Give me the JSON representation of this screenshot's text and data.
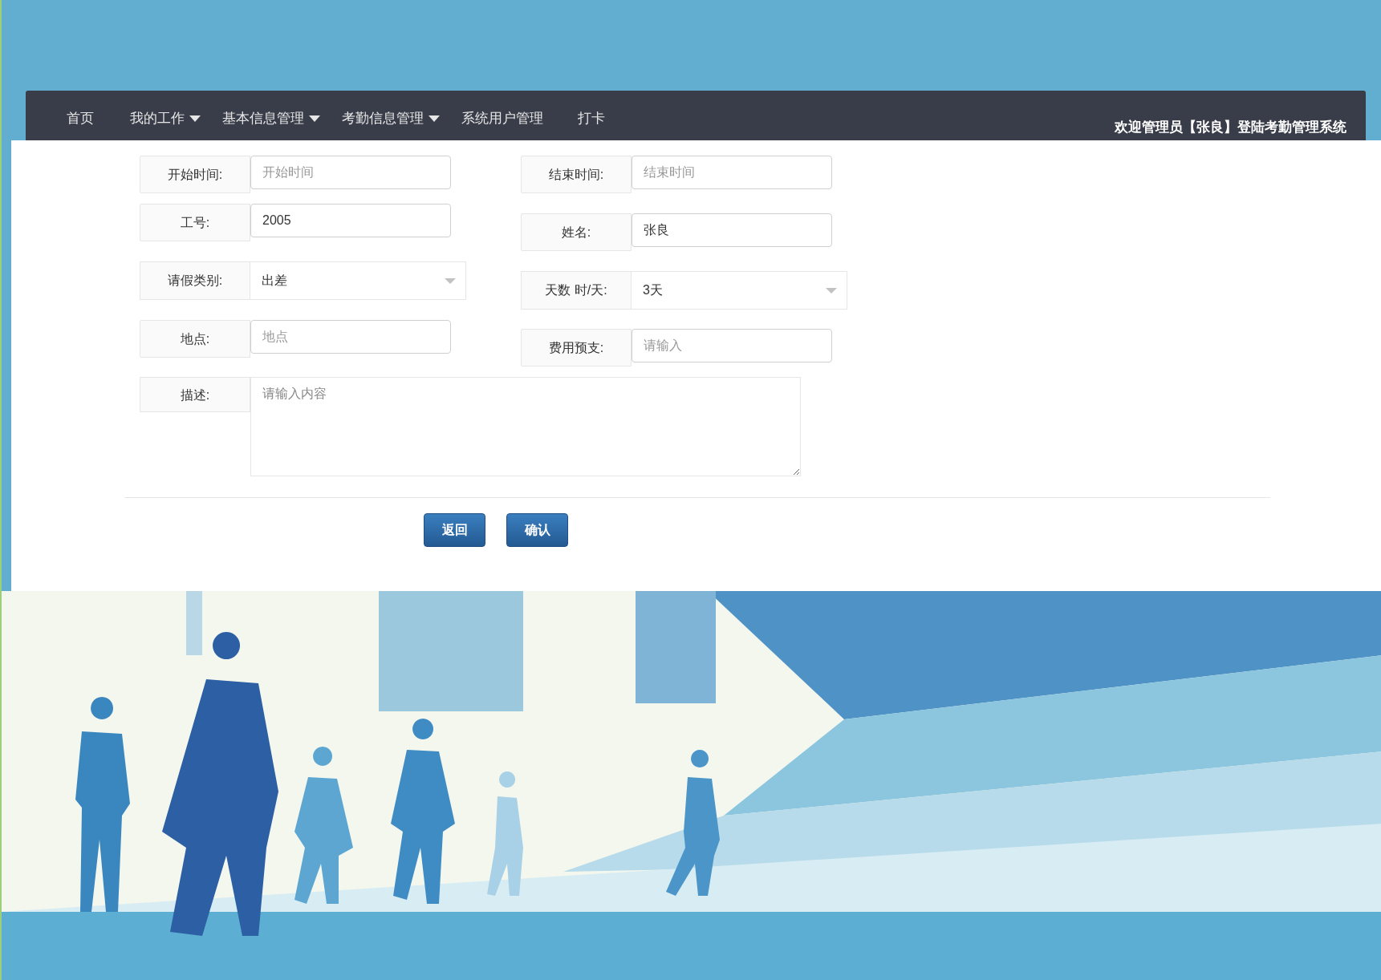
{
  "nav": {
    "items": [
      {
        "label": "首页",
        "dropdown": false
      },
      {
        "label": "我的工作",
        "dropdown": true
      },
      {
        "label": "基本信息管理",
        "dropdown": true
      },
      {
        "label": "考勤信息管理",
        "dropdown": true
      },
      {
        "label": "系统用户管理",
        "dropdown": false
      },
      {
        "label": "打卡",
        "dropdown": false
      }
    ],
    "welcome": "欢迎管理员【张良】登陆考勤管理系统"
  },
  "form": {
    "left": [
      {
        "kind": "input",
        "label": "开始时间:",
        "placeholder": "开始时间"
      },
      {
        "kind": "input",
        "label": "工号:",
        "value": "2005"
      },
      {
        "kind": "select",
        "label": "请假类别:",
        "value": "出差"
      },
      {
        "kind": "input",
        "label": "地点:",
        "placeholder": "地点"
      }
    ],
    "right": [
      {
        "kind": "input",
        "label": "结束时间:",
        "placeholder": "结束时间"
      },
      {
        "kind": "input",
        "label": "姓名:",
        "value": "张良"
      },
      {
        "kind": "select",
        "label": "天数 时/天:",
        "value": "3天"
      },
      {
        "kind": "input",
        "label": "费用预支:",
        "placeholder": "请输入"
      }
    ],
    "description": {
      "label": "描述:",
      "placeholder": "请输入内容"
    },
    "buttons": [
      "返回",
      "确认"
    ]
  }
}
